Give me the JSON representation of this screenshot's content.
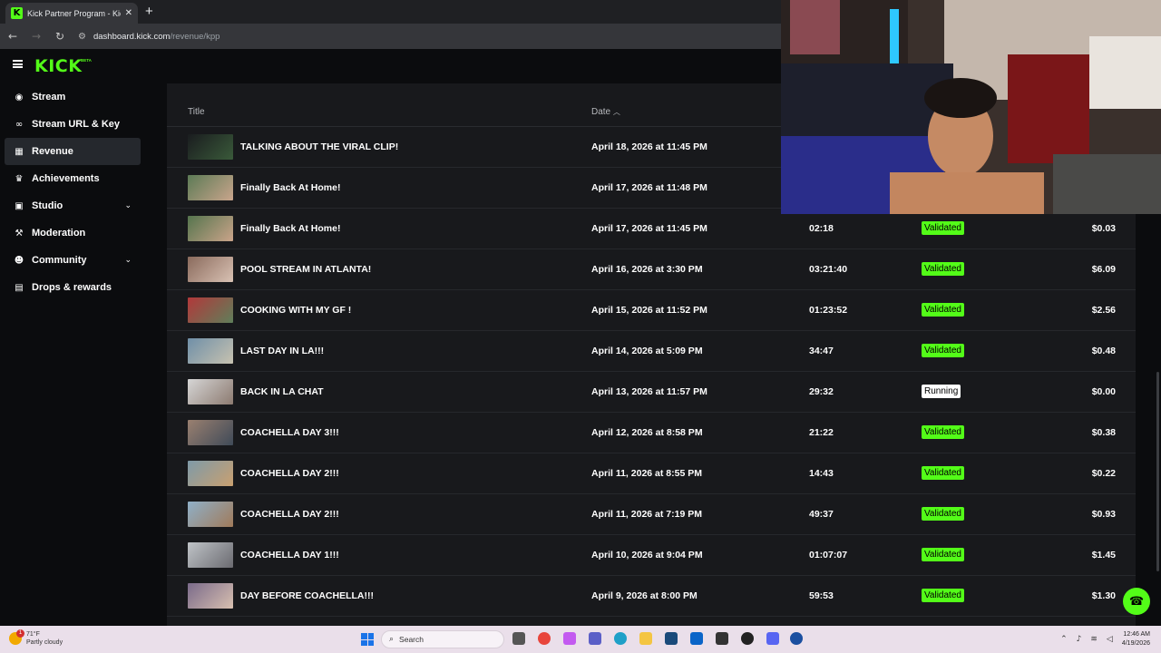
{
  "browser": {
    "tab_title": "Kick Partner Program - Kick Da",
    "url_host": "dashboard.kick.com",
    "url_path": "/revenue/kpp"
  },
  "app": {
    "logo": "KICK",
    "logo_badge": "BETA"
  },
  "sidebar": {
    "items": [
      {
        "label": "Stream",
        "icon": "broadcast-icon",
        "glyph": "((•))",
        "active": false,
        "expandable": false
      },
      {
        "label": "Stream URL & Key",
        "icon": "link-icon",
        "glyph": "🔗",
        "active": false,
        "expandable": false
      },
      {
        "label": "Revenue",
        "icon": "chart-icon",
        "glyph": "▦",
        "active": true,
        "expandable": false
      },
      {
        "label": "Achievements",
        "icon": "trophy-icon",
        "glyph": "🏆",
        "active": false,
        "expandable": false
      },
      {
        "label": "Studio",
        "icon": "studio-icon",
        "glyph": "▣",
        "active": false,
        "expandable": true
      },
      {
        "label": "Moderation",
        "icon": "wrench-icon",
        "glyph": "🔧",
        "active": false,
        "expandable": false
      },
      {
        "label": "Community",
        "icon": "people-icon",
        "glyph": "👥",
        "active": false,
        "expandable": true
      },
      {
        "label": "Drops & rewards",
        "icon": "gift-icon",
        "glyph": "🎁",
        "active": false,
        "expandable": false
      }
    ]
  },
  "table": {
    "columns": {
      "title": "Title",
      "date": "Date"
    },
    "rows": [
      {
        "title": "TALKING ABOUT THE VIRAL CLIP!",
        "date": "April 18, 2026 at 11:45 PM",
        "duration": "",
        "status": "",
        "amount": "",
        "thumb": [
          "#1a1c1f",
          "#3a5a3a"
        ]
      },
      {
        "title": "Finally Back At Home!",
        "date": "April 17, 2026 at 11:48 PM",
        "duration": "",
        "status": "",
        "amount": "",
        "thumb": [
          "#5c7a55",
          "#c9a58c"
        ]
      },
      {
        "title": "Finally Back At Home!",
        "date": "April 17, 2026 at 11:45 PM",
        "duration": "02:18",
        "status": "Validated",
        "amount": "$0.03",
        "thumb": [
          "#55744d",
          "#caa48a"
        ]
      },
      {
        "title": "POOL STREAM IN ATLANTA!",
        "date": "April 16, 2026 at 3:30 PM",
        "duration": "03:21:40",
        "status": "Validated",
        "amount": "$6.09",
        "thumb": [
          "#8a6a5c",
          "#d9c2b4"
        ]
      },
      {
        "title": "COOKING WITH MY GF !",
        "date": "April 15, 2026 at 11:52 PM",
        "duration": "01:23:52",
        "status": "Validated",
        "amount": "$2.56",
        "thumb": [
          "#b2383a",
          "#5f7f5a"
        ]
      },
      {
        "title": "LAST DAY IN LA!!!",
        "date": "April 14, 2026 at 5:09 PM",
        "duration": "34:47",
        "status": "Validated",
        "amount": "$0.48",
        "thumb": [
          "#6f8fa8",
          "#c7c2b0"
        ]
      },
      {
        "title": "BACK IN LA CHAT",
        "date": "April 13, 2026 at 11:57 PM",
        "duration": "29:32",
        "status": "Running",
        "amount": "$0.00",
        "thumb": [
          "#d6d6d6",
          "#8c7a70"
        ]
      },
      {
        "title": "COACHELLA DAY 3!!!",
        "date": "April 12, 2026 at 8:58 PM",
        "duration": "21:22",
        "status": "Validated",
        "amount": "$0.38",
        "thumb": [
          "#9a8070",
          "#3f4a58"
        ]
      },
      {
        "title": "COACHELLA DAY 2!!!",
        "date": "April 11, 2026 at 8:55 PM",
        "duration": "14:43",
        "status": "Validated",
        "amount": "$0.22",
        "thumb": [
          "#7e9aa8",
          "#c9a070"
        ]
      },
      {
        "title": "COACHELLA DAY 2!!!",
        "date": "April 11, 2026 at 7:19 PM",
        "duration": "49:37",
        "status": "Validated",
        "amount": "$0.93",
        "thumb": [
          "#8fb0c8",
          "#a07a5a"
        ]
      },
      {
        "title": "COACHELLA DAY 1!!!",
        "date": "April 10, 2026 at 9:04 PM",
        "duration": "01:07:07",
        "status": "Validated",
        "amount": "$1.45",
        "thumb": [
          "#c0c4c8",
          "#6a6a70"
        ]
      },
      {
        "title": "DAY BEFORE COACHELLA!!!",
        "date": "April 9, 2026 at 8:00 PM",
        "duration": "59:53",
        "status": "Validated",
        "amount": "$1.30",
        "thumb": [
          "#7a6a8a",
          "#d8c0b0"
        ]
      }
    ]
  },
  "taskbar": {
    "weather_temp": "71°F",
    "weather_desc": "Partly cloudy",
    "weather_badge": "1",
    "search_placeholder": "Search",
    "time": "12:46 AM",
    "date": "4/19/2026"
  },
  "colors": {
    "accent": "#53fc18",
    "content_bg": "#18191c",
    "page_bg": "#0b0c0e"
  }
}
